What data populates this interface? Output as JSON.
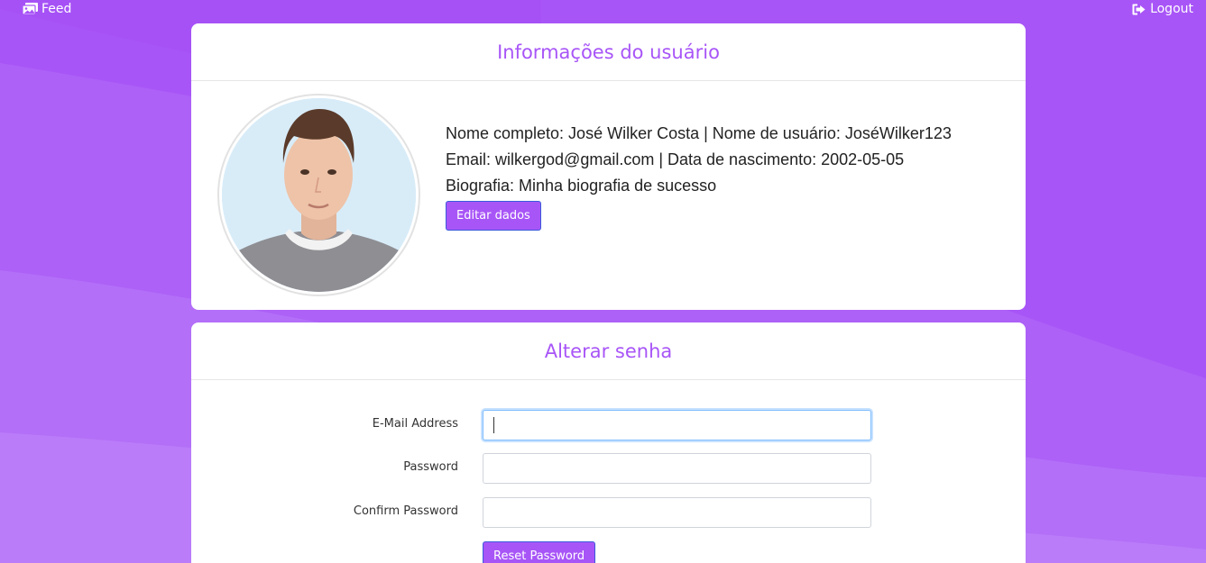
{
  "nav": {
    "feed_label": "Feed",
    "logout_label": "Logout",
    "feed_icon": "images-icon",
    "logout_icon": "sign-out-icon"
  },
  "profile_card": {
    "title": "Informações do usuário",
    "avatar_alt": "avatar",
    "line1": "Nome completo: José Wilker Costa | Nome de usuário: JoséWilker123",
    "line2": "Email: wilkergod@gmail.com | Data de nascimento: 2002-05-05",
    "line3": "Biografia: Minha biografia de sucesso",
    "edit_button": "Editar dados"
  },
  "password_card": {
    "title": "Alterar senha",
    "email_label": "E-Mail Address",
    "email_value": "",
    "password_label": "Password",
    "password_value": "",
    "confirm_label": "Confirm Password",
    "confirm_value": "",
    "reset_button": "Reset Password"
  },
  "colors": {
    "accent": "#a855f7",
    "background": "#a855f7",
    "card": "#ffffff",
    "focus": "#80bdff"
  }
}
